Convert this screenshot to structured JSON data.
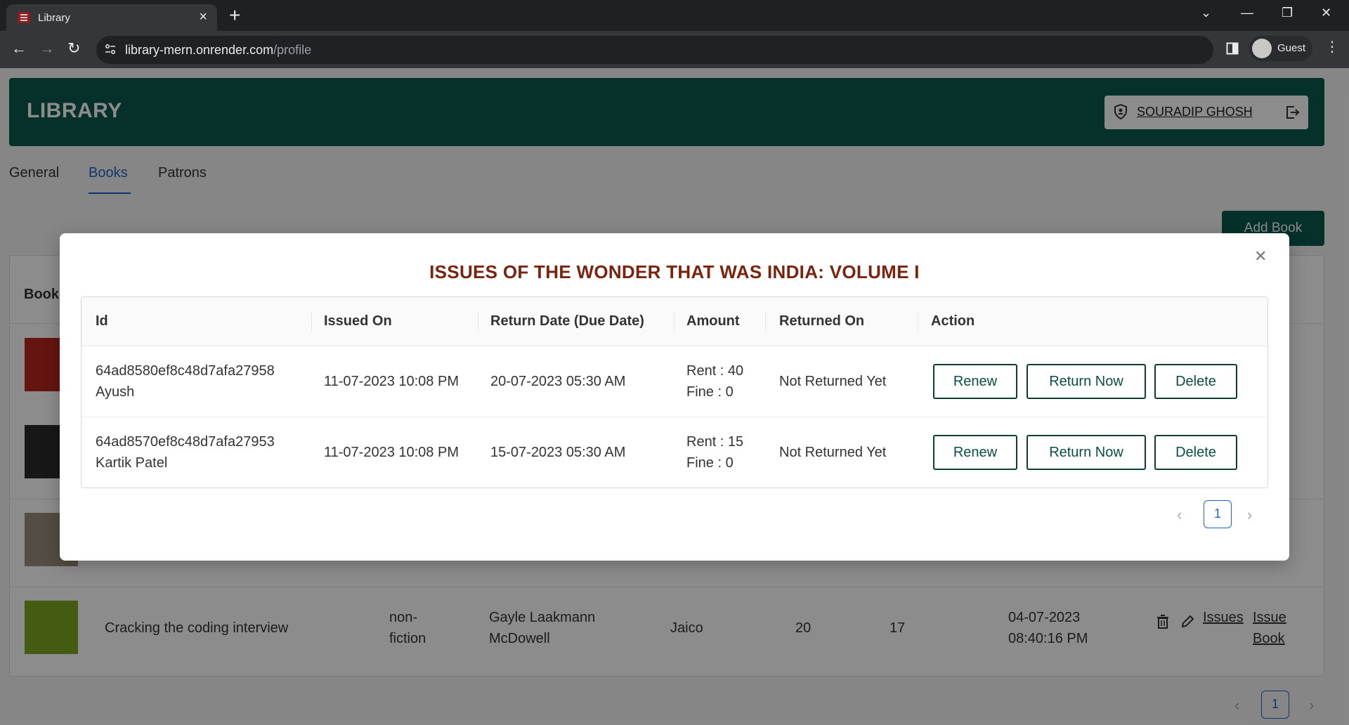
{
  "browser": {
    "tab_title": "Library",
    "url_host": "library-mern.onrender.com",
    "url_path": "/profile",
    "profile_label": "Guest"
  },
  "app": {
    "logo": "LIBRARY",
    "user_name": "SOURADIP GHOSH",
    "tabs": [
      "General",
      "Books",
      "Patrons"
    ],
    "active_tab": "Books",
    "add_book_label": "Add Book",
    "books_heading": "Book"
  },
  "book_row": {
    "title": "Cracking the coding interview",
    "category": [
      "non-",
      "fiction"
    ],
    "author": [
      "Gayle Laakmann",
      "McDowell"
    ],
    "publisher": "Jaico",
    "col_a": "20",
    "col_b": "17",
    "added": [
      "04-07-2023",
      "08:40:16 PM"
    ],
    "issues_link": "Issues",
    "issue_book_link": [
      "Issue",
      "Book"
    ]
  },
  "modal": {
    "title": "ISSUES OF THE WONDER THAT WAS INDIA: VOLUME I",
    "columns": [
      "Id",
      "Issued On",
      "Return Date (Due Date)",
      "Amount",
      "Returned On",
      "Action"
    ],
    "rows": [
      {
        "id": "64ad8580ef8c48d7afa27958",
        "patron": "Ayush",
        "issued_on": "11-07-2023 10:08 PM",
        "due_date": "20-07-2023 05:30 AM",
        "rent": "Rent : 40",
        "fine": "Fine : 0",
        "returned_on": "Not Returned Yet"
      },
      {
        "id": "64ad8570ef8c48d7afa27953",
        "patron": "Kartik Patel",
        "issued_on": "11-07-2023 10:08 PM",
        "due_date": "15-07-2023 05:30 AM",
        "rent": "Rent : 15",
        "fine": "Fine : 0",
        "returned_on": "Not Returned Yet"
      }
    ],
    "actions": {
      "renew": "Renew",
      "return_now": "Return Now",
      "delete": "Delete"
    },
    "page": "1"
  },
  "bottom_page": "1",
  "colors": {
    "header_bg": "#0a5a4e",
    "modal_title": "#7a2410",
    "active_tab": "#1d63c9"
  }
}
